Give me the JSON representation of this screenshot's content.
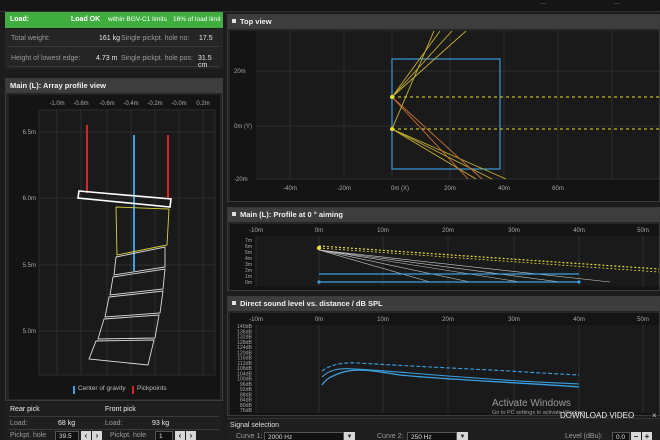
{
  "topbar": {
    "right1": "…",
    "right2": "…"
  },
  "load": {
    "label": "Load:",
    "status": "Load OK",
    "detail": "within BGV-C1 limits",
    "percent": "16% of load limit",
    "total_weight_label": "Total weight:",
    "total_weight_value": "161 kg",
    "single_pickpt_hole_label": "Single pickpt. hole no:",
    "single_pickpt_hole_value": "17.5",
    "lowest_edge_label": "Height of lowest edge:",
    "lowest_edge_value": "4.73 m",
    "single_pickpt_pos_label": "Single pickpt. hole pos:",
    "single_pickpt_pos_value": "31.5 cm"
  },
  "array_profile": {
    "title": "Main (L): Array profile view",
    "xticks": [
      "-1.0m",
      "-0.8m",
      "-0.6m",
      "-0.4m",
      "-0.2m",
      "-0.0m",
      "0.2m"
    ],
    "yticks": [
      "6.5m",
      "6.0m",
      "5.5m",
      "5.0m"
    ],
    "legend_cog": "Center of gravity",
    "legend_pick": "Pickpoints"
  },
  "picks": {
    "rear_title": "Rear pick",
    "front_title": "Front pick",
    "load_label": "Load:",
    "rear_load": "68 kg",
    "front_load": "93 kg",
    "pickpt_hole_label": "Pickpt. hole",
    "rear_hole": "39.5",
    "front_hole": "1"
  },
  "top_view": {
    "title": "Top view",
    "xticks": [
      "-40m",
      "-20m",
      "0m (X)",
      "20m",
      "40m",
      "60m"
    ],
    "yticks": [
      "20m",
      "0m (Y)",
      "-20m"
    ]
  },
  "profile_aiming": {
    "title": "Main (L): Profile at 0 ° aiming",
    "xticks": [
      "-10m",
      "0m",
      "10m",
      "20m",
      "30m",
      "40m",
      "50m"
    ],
    "yticks": [
      "7m",
      "6m",
      "5m",
      "4m",
      "3m",
      "2m",
      "1m",
      "0m"
    ]
  },
  "spl": {
    "title": "Direct sound level vs. distance / dB SPL",
    "xticks": [
      "-10m",
      "0m",
      "10m",
      "20m",
      "30m",
      "40m",
      "50m"
    ],
    "yticks": [
      "140dB",
      "136dB",
      "132dB",
      "128dB",
      "124dB",
      "120dB",
      "116dB",
      "112dB",
      "108dB",
      "104dB",
      "100dB",
      "96dB",
      "92dB",
      "88dB",
      "84dB",
      "80dB",
      "76dB"
    ]
  },
  "signal": {
    "title": "Signal selection",
    "curve1_label": "Curve 1:",
    "curve1_value": "2000 Hz",
    "curve2_label": "Curve 2:",
    "curve2_value": "250 Hz",
    "level_label": "Level (dBu):",
    "level_value": "0.0"
  },
  "watermark": {
    "line1": "Activate Windows",
    "line2": "Go to PC settings to activate Windows.",
    "download": "DOWNLOAD VIDEO"
  },
  "colors": {
    "ok_green": "#3fae3f",
    "cog_blue": "#3aa0e0",
    "pick_red": "#e02020",
    "ray_yellow": "#e8e030",
    "grid": "#2e2e2e"
  }
}
